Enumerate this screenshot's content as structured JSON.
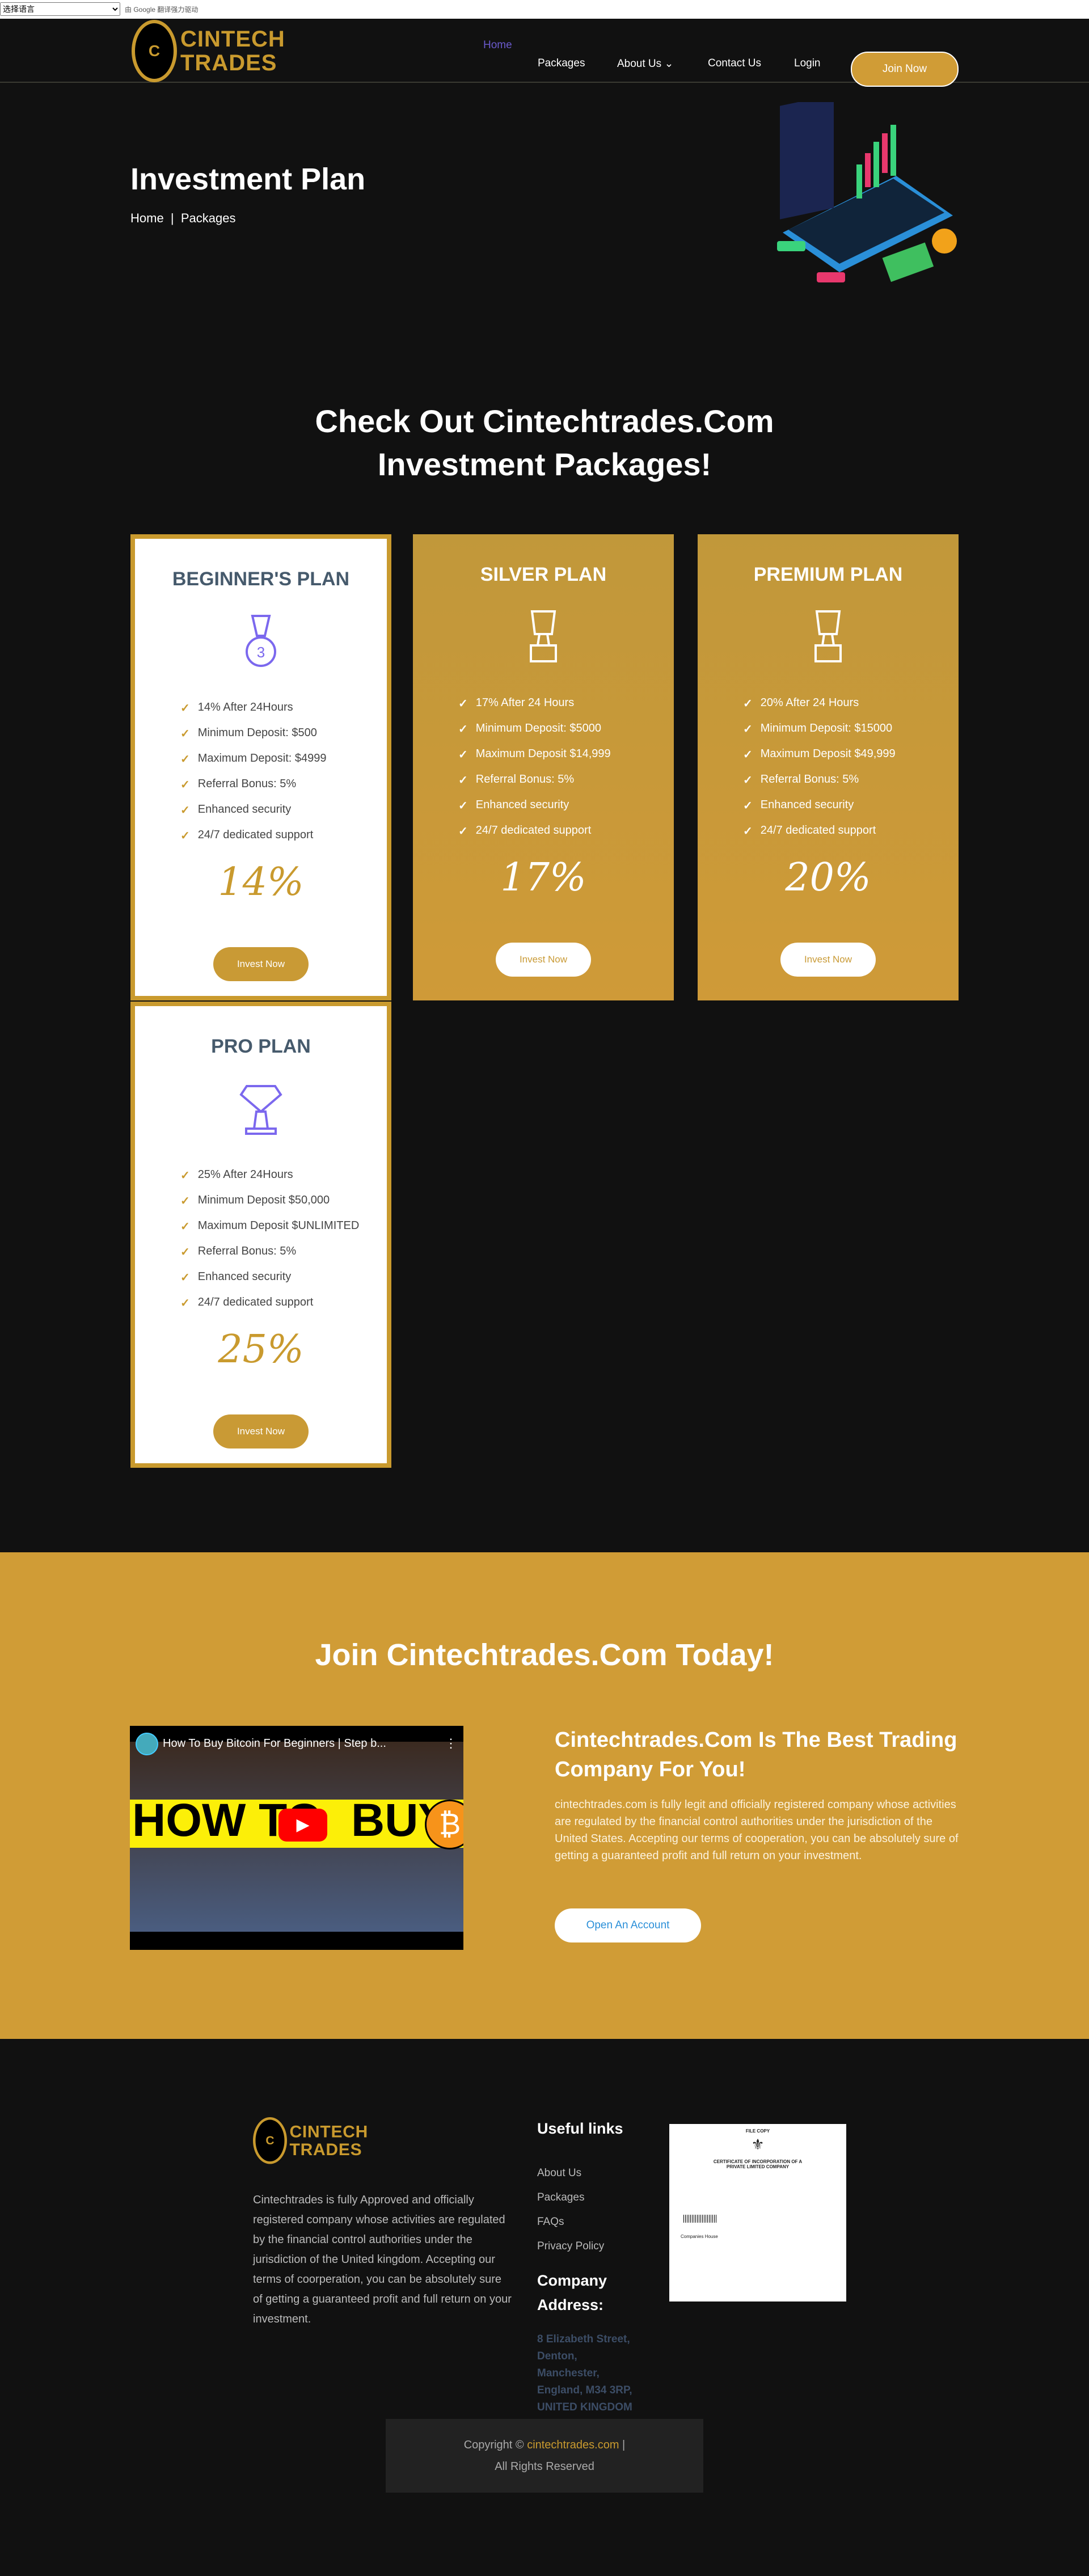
{
  "translate": {
    "select_label": "选择语言",
    "powered": "由 Google 翻译强力驱动"
  },
  "header": {
    "logo_top": "CINTECH",
    "logo_bottom": "TRADES",
    "nav": [
      "Home",
      "Packages",
      "About Us",
      "Contact Us",
      "Login"
    ],
    "join": "Join Now"
  },
  "hero": {
    "title": "Investment Plan",
    "crumb_home": "Home",
    "crumb_sep": "|",
    "crumb_current": "Packages"
  },
  "packages": {
    "heading1": "Check Out Cintechtrades.Com",
    "heading2": "Investment Packages!",
    "plans": [
      {
        "name": "BEGINNER'S PLAN",
        "icon": "medal-icon",
        "features": [
          "14% After 24Hours",
          "Minimum Deposit: $500",
          "Maximum Deposit: $4999",
          "Referral Bonus: 5%",
          "Enhanced security",
          "24/7 dedicated support"
        ],
        "rate": "14%",
        "button": "Invest Now"
      },
      {
        "name": "SILVER PLAN",
        "icon": "trophy-icon",
        "features": [
          "17% After 24 Hours",
          "Minimum Deposit: $5000",
          "Maximum Deposit $14,999",
          "Referral Bonus: 5%",
          "Enhanced security",
          "24/7 dedicated support"
        ],
        "rate": "17%",
        "button": "Invest Now"
      },
      {
        "name": "PREMIUM PLAN",
        "icon": "trophy-icon",
        "features": [
          "20% After 24 Hours",
          "Minimum Deposit: $15000",
          "Maximum Deposit $49,999",
          "Referral Bonus: 5%",
          "Enhanced security",
          "24/7 dedicated support"
        ],
        "rate": "20%",
        "button": "Invest Now"
      },
      {
        "name": "PRO PLAN",
        "icon": "diamond-trophy-icon",
        "features": [
          "25% After 24Hours",
          "Minimum Deposit $50,000",
          "Maximum Deposit $UNLIMITED",
          "Referral Bonus: 5%",
          "Enhanced security",
          "24/7 dedicated support"
        ],
        "rate": "25%",
        "button": "Invest Now"
      }
    ]
  },
  "join": {
    "heading": "Join Cintechtrades.Com Today!",
    "video_title": "How To Buy Bitcoin For Beginners | Step b...",
    "thumb_left": "HOW TO",
    "thumb_right": "BUY",
    "subheading": "Cintechtrades.Com Is The Best Trading Company For You!",
    "body": "cintechtrades.com is fully legit and officially registered company whose activities are regulated by the financial control authorities under the jurisdiction of the United States. Accepting our terms of cooperation, you can be absolutely sure of getting a guaranteed profit and full return on your investment.",
    "button": "Open An Account"
  },
  "footer": {
    "about": "Cintechtrades is fully Approved and officially registered company whose activities are regulated by the financial control authorities under the jurisdiction of the United kingdom. Accepting our terms of coorperation, you can be absolutely sure of getting a guaranteed profit and full return on your investment.",
    "links_title": "Useful links",
    "links": [
      "About Us",
      "Packages",
      "FAQs",
      "Privacy Policy"
    ],
    "address_title": "Company Address:",
    "address": [
      "8 Elizabeth Street,",
      "Denton,",
      "Manchester,",
      "England, M34 3RP,",
      "UNITED KINGDOM"
    ],
    "cert": {
      "file_copy": "FILE COPY",
      "title": "CERTIFICATE OF INCORPORATION OF A PRIVATE LIMITED COMPANY",
      "house": "Companies House"
    },
    "copyright": "Copyright © ",
    "copyright_link": "cintechtrades.com",
    "copyright_sep": " |",
    "rights": "All Rights Reserved"
  },
  "colors": {
    "gold": "#c99a2e",
    "dark": "#111111",
    "link_blue": "#3c4d66",
    "active_nav": "#6a5acd"
  }
}
